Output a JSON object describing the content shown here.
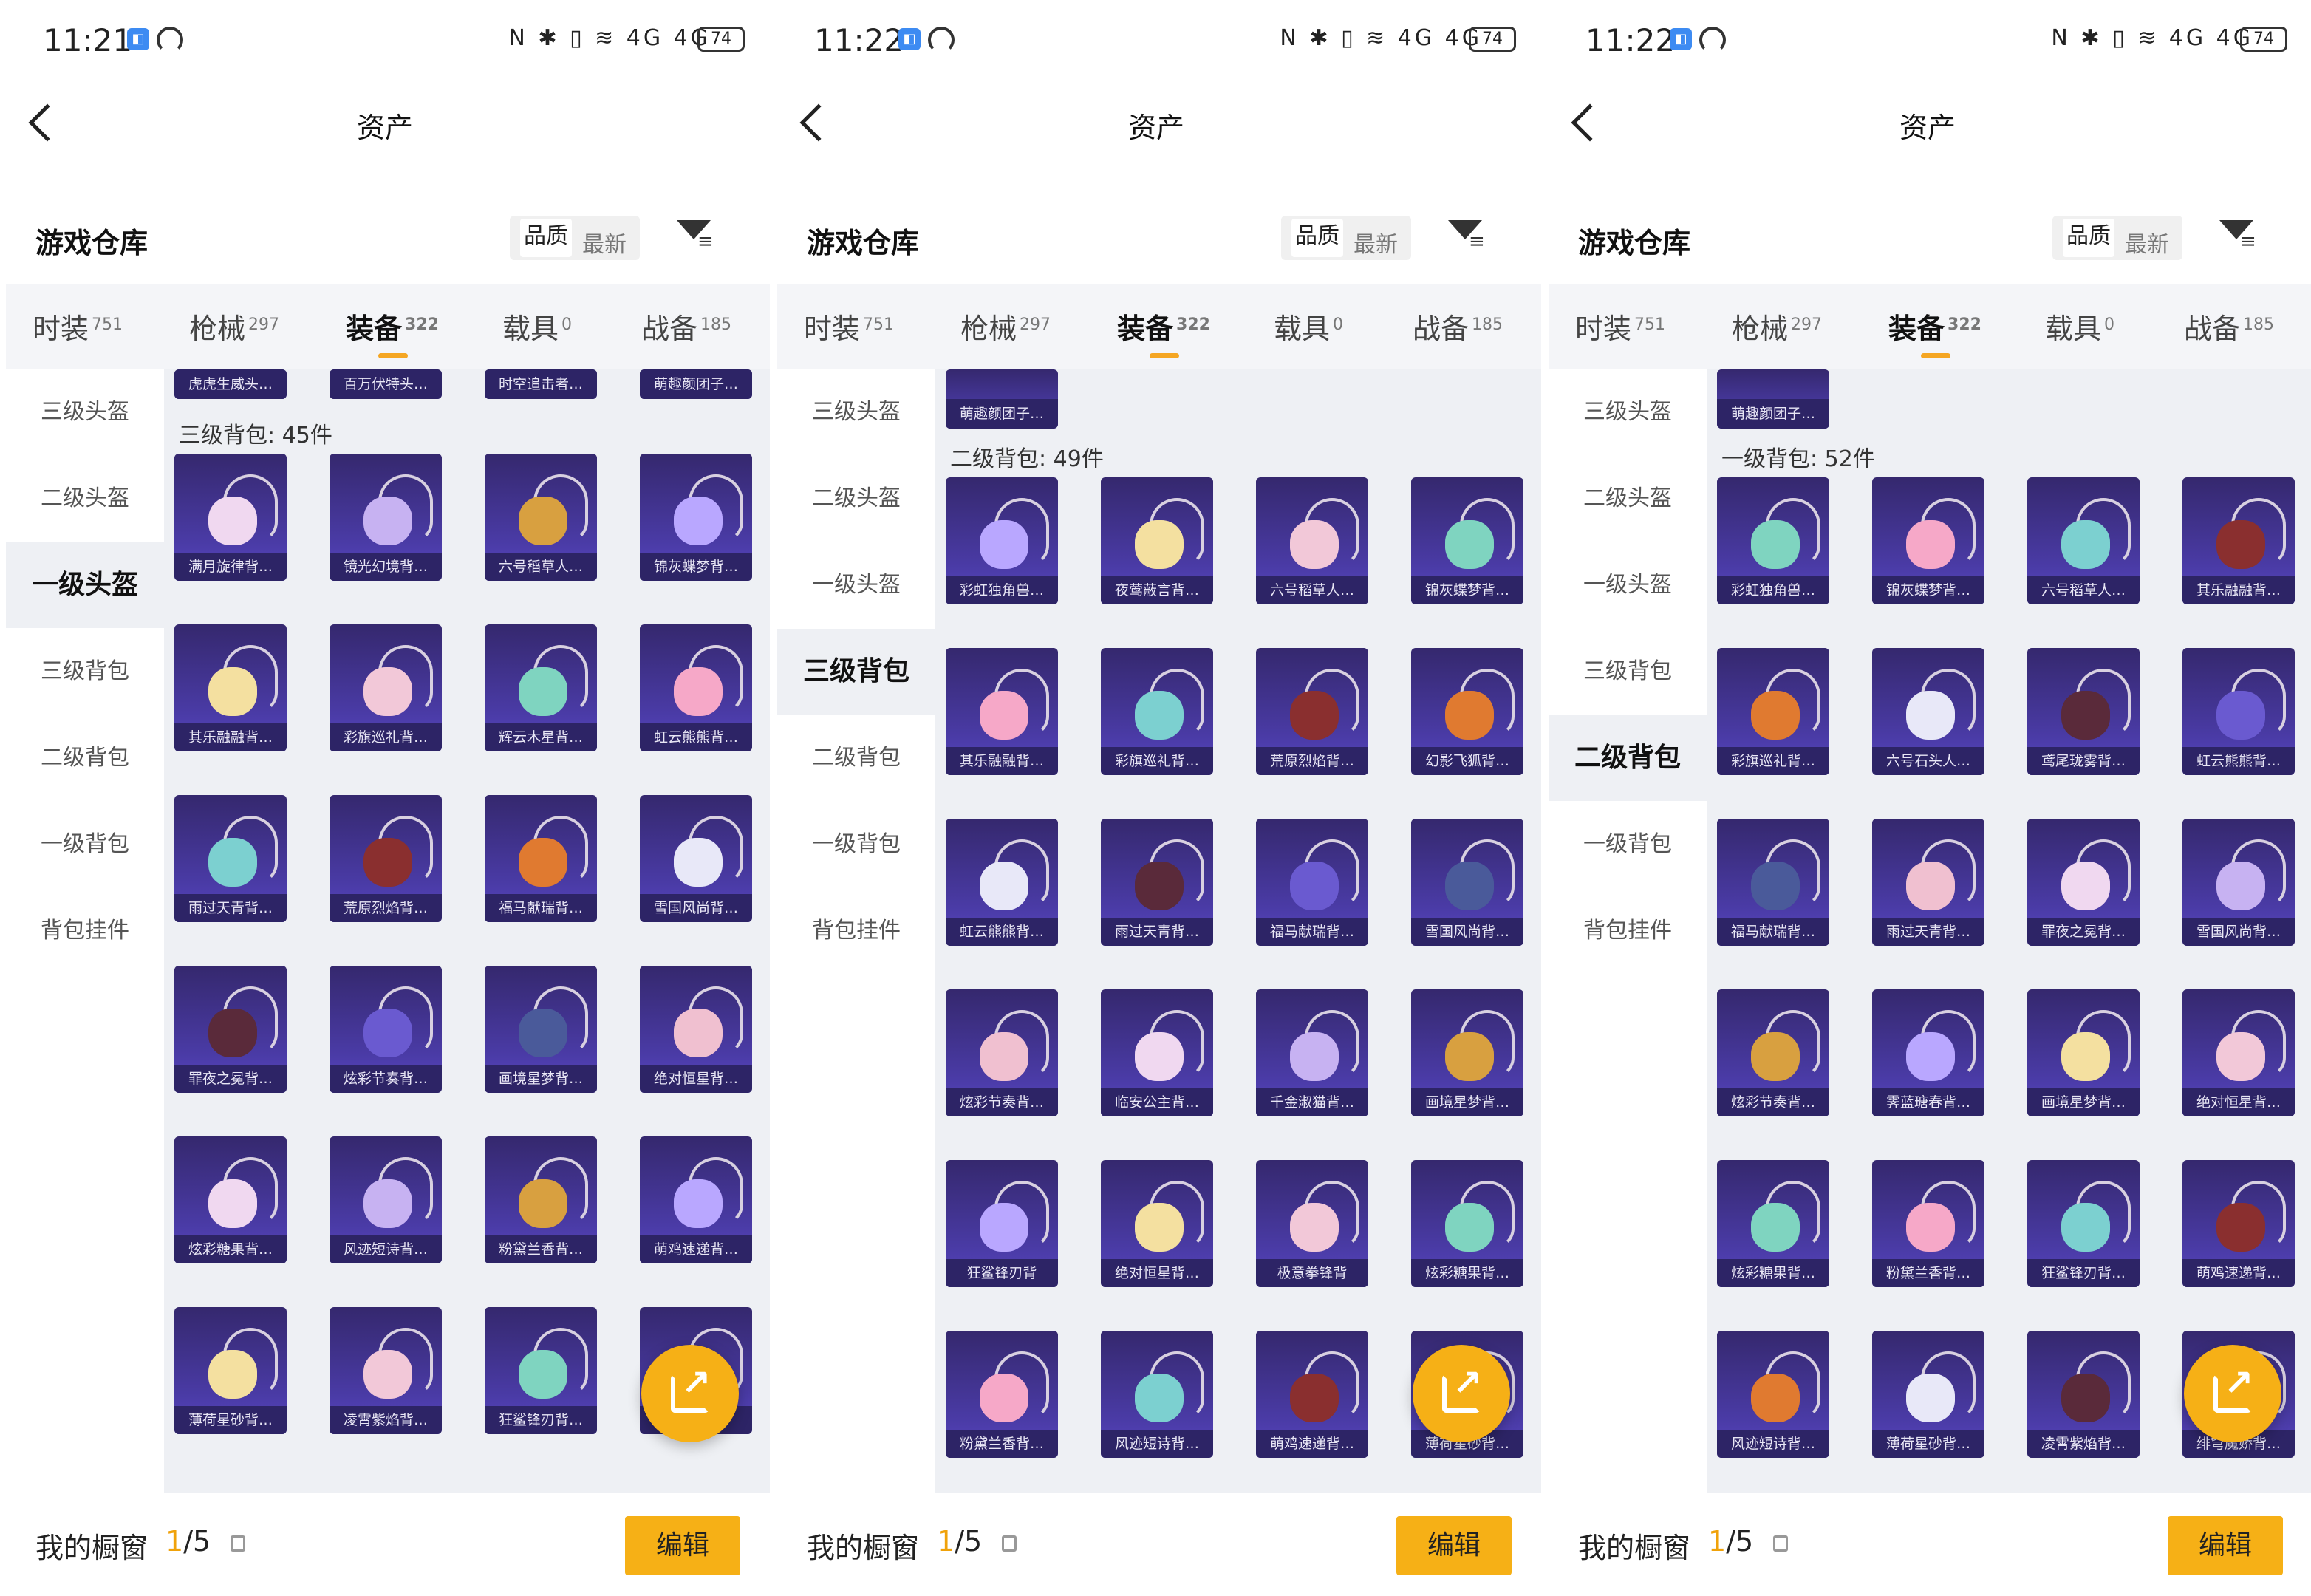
{
  "status": {
    "times": [
      "11:21",
      "11:22",
      "11:22"
    ],
    "battery": "74",
    "icons": "N ✱ ▯ ≋ 4G 4G"
  },
  "nav": {
    "title": "资产"
  },
  "header": {
    "title": "游戏仓库",
    "sort_quality": "品质",
    "sort_latest": "最新"
  },
  "tabs": [
    {
      "label": "时装",
      "count": "751"
    },
    {
      "label": "枪械",
      "count": "297"
    },
    {
      "label": "装备",
      "count": "322"
    },
    {
      "label": "载具",
      "count": "0"
    },
    {
      "label": "战备",
      "count": "185"
    }
  ],
  "sidebar": [
    "三级头盔",
    "二级头盔",
    "一级头盔",
    "三级背包",
    "二级背包",
    "一级背包",
    "背包挂件"
  ],
  "footer": {
    "label": "我的橱窗",
    "current": "1",
    "total": "/5",
    "edit": "编辑"
  },
  "panels": [
    {
      "active_sidebar": 2,
      "top_items": [
        "虎虎生威头…",
        "百万伏特头…",
        "时空追击者…",
        "萌趣颜团子…"
      ],
      "section": "三级背包: 45件",
      "items": [
        "满月旋律背…",
        "镜光幻境背…",
        "六号稻草人…",
        "锦灰蝶梦背…",
        "其乐融融背…",
        "彩旗巡礼背…",
        "辉云木星背…",
        "虹云熊熊背…",
        "雨过天青背…",
        "荒原烈焰背…",
        "福马献瑞背…",
        "雪国风尚背…",
        "罪夜之冕背…",
        "炫彩节奏背…",
        "画境星梦背…",
        "绝对恒星背…",
        "炫彩糖果背…",
        "风迹短诗背…",
        "粉黛兰香背…",
        "萌鸡速递背…",
        "薄荷星砂背…",
        "凌霄紫焰背…",
        "狂鲨锋刃背…",
        "…"
      ]
    },
    {
      "active_sidebar": 3,
      "top_items": [
        "萌趣颜团子…"
      ],
      "section": "二级背包: 49件",
      "items": [
        "彩虹独角兽…",
        "夜莺蔽言背…",
        "六号稻草人…",
        "锦灰蝶梦背…",
        "其乐融融背…",
        "彩旗巡礼背…",
        "荒原烈焰背…",
        "幻影飞狐背…",
        "虹云熊熊背…",
        "雨过天青背…",
        "福马献瑞背…",
        "雪国风尚背…",
        "炫彩节奏背…",
        "临安公主背…",
        "千金淑猫背…",
        "画境星梦背…",
        "狂鲨锋刃背",
        "绝对恒星背…",
        "极意拳锋背",
        "炫彩糖果背…",
        "粉黛兰香背…",
        "风迹短诗背…",
        "萌鸡速递背…",
        "薄荷星砂背…"
      ]
    },
    {
      "active_sidebar": 4,
      "top_items": [
        "萌趣颜团子…"
      ],
      "section": "一级背包: 52件",
      "items": [
        "彩虹独角兽…",
        "锦灰蝶梦背…",
        "六号稻草人…",
        "其乐融融背…",
        "彩旗巡礼背…",
        "六号石头人…",
        "鸢尾珑雾背…",
        "虹云熊熊背…",
        "福马献瑞背…",
        "雨过天青背…",
        "罪夜之冕背…",
        "雪国风尚背…",
        "炫彩节奏背…",
        "霁蓝瑭春背…",
        "画境星梦背…",
        "绝对恒星背…",
        "炫彩糖果背…",
        "粉黛兰香背…",
        "狂鲨锋刃背…",
        "萌鸡速递背…",
        "风迹短诗背…",
        "薄荷星砂背…",
        "凌霄紫焰背…",
        "绯穹魔娇背…"
      ]
    }
  ],
  "art_colors": [
    "#f0d8f0",
    "#c7b2f2",
    "#d8a040",
    "#b9a7ff",
    "#f4e0a0",
    "#f2c8d8",
    "#7fd4c0",
    "#f6a8c8",
    "#7cd0d0",
    "#8a2f2f",
    "#e07a30",
    "#e8e8f8",
    "#5a2a3a",
    "#6a5ad0",
    "#4a5a9a",
    "#f0c0d0"
  ]
}
